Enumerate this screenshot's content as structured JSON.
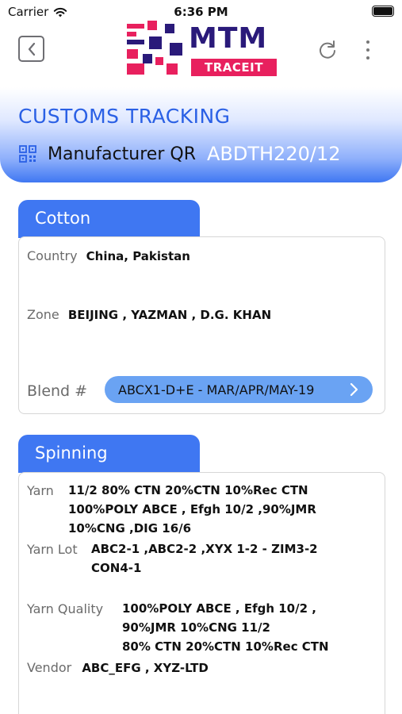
{
  "status": {
    "carrier": "Carrier",
    "time": "6:36 PM"
  },
  "nav": {
    "back_icon": "chevron-left-icon",
    "refresh_icon": "refresh-icon",
    "menu_icon": "more-vertical-icon"
  },
  "logo": {
    "name": "MTM",
    "tagline": "TRACEIT"
  },
  "header": {
    "title": "CUSTOMS TRACKING",
    "qr_label": "Manufacturer QR",
    "qr_value": "ABDTH220/12"
  },
  "cotton": {
    "tab_label": "Cotton",
    "country_label": "Country",
    "country_value": "China, Pakistan",
    "zone_label": "Zone",
    "zone_value": "BEIJING , YAZMAN , D.G. KHAN",
    "blend_label": "Blend #",
    "blend_value": "ABCX1-D+E - MAR/APR/MAY-19"
  },
  "spinning": {
    "tab_label": "Spinning",
    "yarn_label": "Yarn",
    "yarn_lines": [
      "11/2 80% CTN 20%CTN 10%Rec CTN",
      "100%POLY ABCE , Efgh 10/2 ,90%JMR",
      "10%CNG ,DIG 16/6"
    ],
    "yarn_lot_label": "Yarn Lot",
    "yarn_lot_lines": [
      "ABC2-1 ,ABC2-2 ,XYX 1-2 - ZIM3-2",
      "CON4-1"
    ],
    "yarn_quality_label": "Yarn Quality",
    "yarn_quality_lines": [
      "100%POLY ABCE , Efgh 10/2 ,",
      "90%JMR 10%CNG 11/2",
      "80% CTN 20%CTN 10%Rec CTN"
    ],
    "vendor_label": "Vendor",
    "vendor_value": "ABC_EFG , XYZ-LTD"
  },
  "colors": {
    "accent": "#3f77f2",
    "title_blue": "#2a60e5",
    "pill": "#6aa3f3",
    "brand_navy": "#2a1a7a",
    "brand_pink": "#e8205e"
  }
}
